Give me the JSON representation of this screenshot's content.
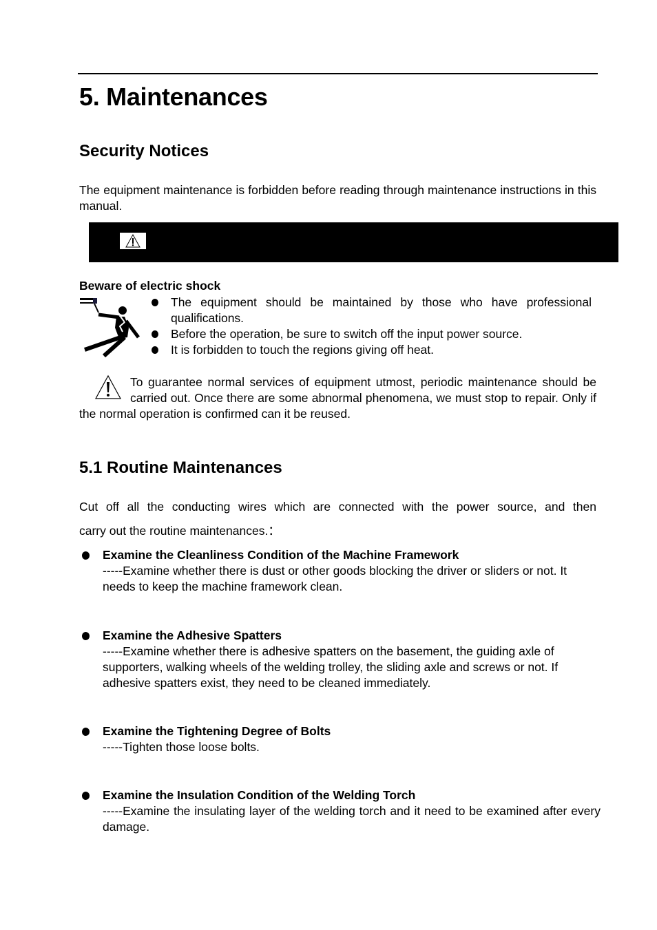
{
  "chapter_title": "5. Maintenances",
  "security": {
    "heading": "Security Notices",
    "intro": "The equipment maintenance is forbidden before reading through maintenance instructions in this manual.",
    "warning_icon": "warning-triangle-icon",
    "electric_shock": {
      "title": "Beware of electric shock",
      "icon": "electric-shock-icon",
      "bullets": [
        "The equipment should be maintained by those who have professional qualifications.",
        "Before the operation, be sure to switch off the input power source.",
        "It is forbidden to touch the regions giving off heat."
      ]
    },
    "caution": {
      "icon": "caution-triangle-icon",
      "text": "To guarantee normal services of equipment utmost, periodic maintenance should be carried out. Once there are some abnormal phenomena, we must stop to repair. Only if the normal operation is confirmed can it be reused."
    }
  },
  "routine": {
    "heading": "5.1 Routine Maintenances",
    "intro_line1": "Cut off all the conducting wires which are connected with the power source, and then",
    "intro_line2": "carry out the routine maintenances.：",
    "items": [
      {
        "title": "Examine the Cleanliness Condition of the Machine Framework",
        "body": "-----Examine whether there is dust or other goods blocking the driver or sliders or not. It needs to keep the machine framework clean."
      },
      {
        "title": "Examine the Adhesive Spatters",
        "body": "-----Examine whether there is adhesive spatters on the basement, the guiding axle of supporters, walking wheels of the welding trolley, the sliding axle and screws or not. If adhesive spatters exist, they need to be cleaned immediately."
      },
      {
        "title": "Examine the Tightening Degree of Bolts",
        "body": "-----Tighten those loose bolts."
      },
      {
        "title": "Examine the Insulation Condition of the Welding Torch",
        "body": "-----Examine the insulating layer of the welding torch and it need to be examined after every damage."
      }
    ]
  }
}
